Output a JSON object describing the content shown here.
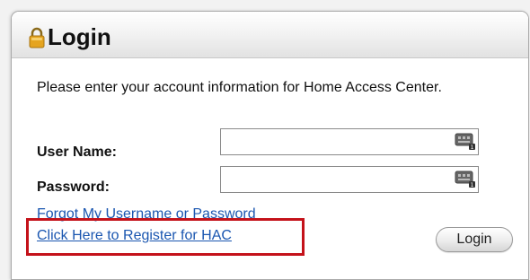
{
  "panel": {
    "title": "Login"
  },
  "form": {
    "intro": "Please enter your account information for Home Access Center.",
    "username_label": "User Name:",
    "username_value": "",
    "password_label": "Password:",
    "password_value": ""
  },
  "links": {
    "forgot": "Forgot My Username or Password",
    "register": "Click Here to Register for HAC"
  },
  "buttons": {
    "login": "Login"
  },
  "icons": {
    "header": "lock-icon",
    "fields": "keyboard-icon"
  },
  "colors": {
    "link": "#1a56b0",
    "highlight": "#c4121a",
    "lock": "#e0a020"
  }
}
